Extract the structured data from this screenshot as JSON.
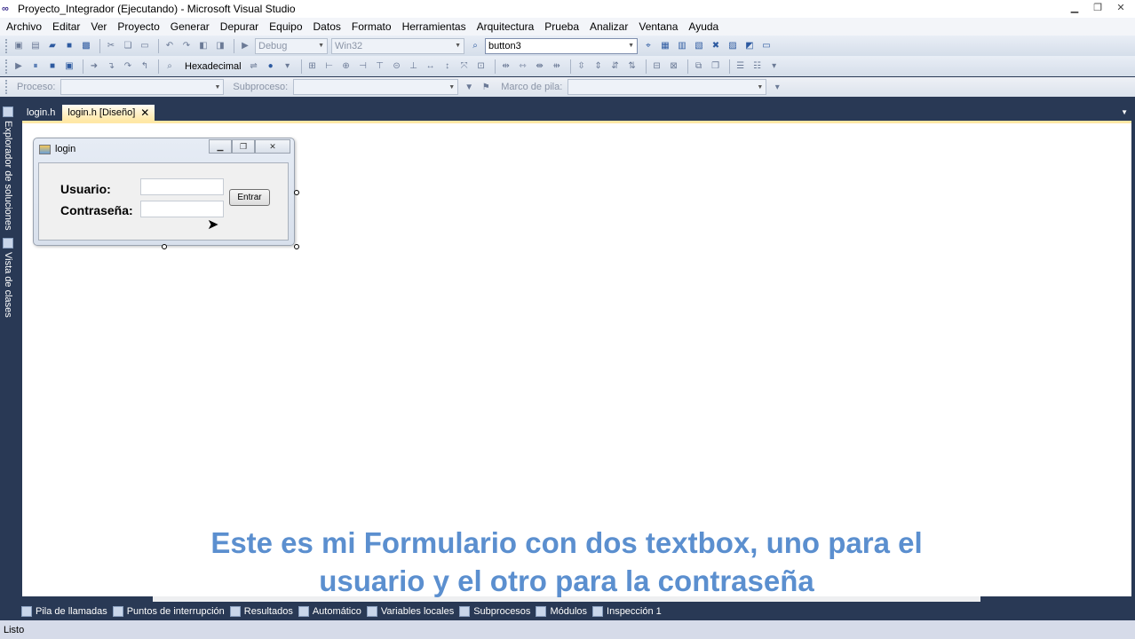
{
  "window": {
    "title": "Proyecto_Integrador (Ejecutando) - Microsoft Visual Studio",
    "logo": "∞"
  },
  "menu": [
    "Archivo",
    "Editar",
    "Ver",
    "Proyecto",
    "Generar",
    "Depurar",
    "Equipo",
    "Datos",
    "Formato",
    "Herramientas",
    "Arquitectura",
    "Prueba",
    "Analizar",
    "Ventana",
    "Ayuda"
  ],
  "toolbar1": {
    "config": "Debug",
    "platform": "Win32",
    "find_value": "button3"
  },
  "toolbar2": {
    "hex_label": "Hexadecimal"
  },
  "toolbar3": {
    "process_label": "Proceso:",
    "thread_label": "Subproceso:",
    "stack_label": "Marco de pila:"
  },
  "left_tabs": [
    "Explorador de soluciones",
    "Vista de clases"
  ],
  "doc_tabs": [
    {
      "label": "login.h"
    },
    {
      "label": "login.h [Diseño]",
      "close": "✕"
    }
  ],
  "form": {
    "title": "login",
    "user_label": "Usuario:",
    "password_label": "Contraseña:",
    "button_label": "Entrar"
  },
  "subtitle": {
    "line1": "Este es mi Formulario con dos textbox, uno para el",
    "line2": "usuario y el otro para la contraseña"
  },
  "bottom_tabs": [
    "Pila de llamadas",
    "Puntos de interrupción",
    "Resultados",
    "Automático",
    "Variables locales",
    "Subprocesos",
    "Módulos",
    "Inspección 1"
  ],
  "status": "Listo"
}
